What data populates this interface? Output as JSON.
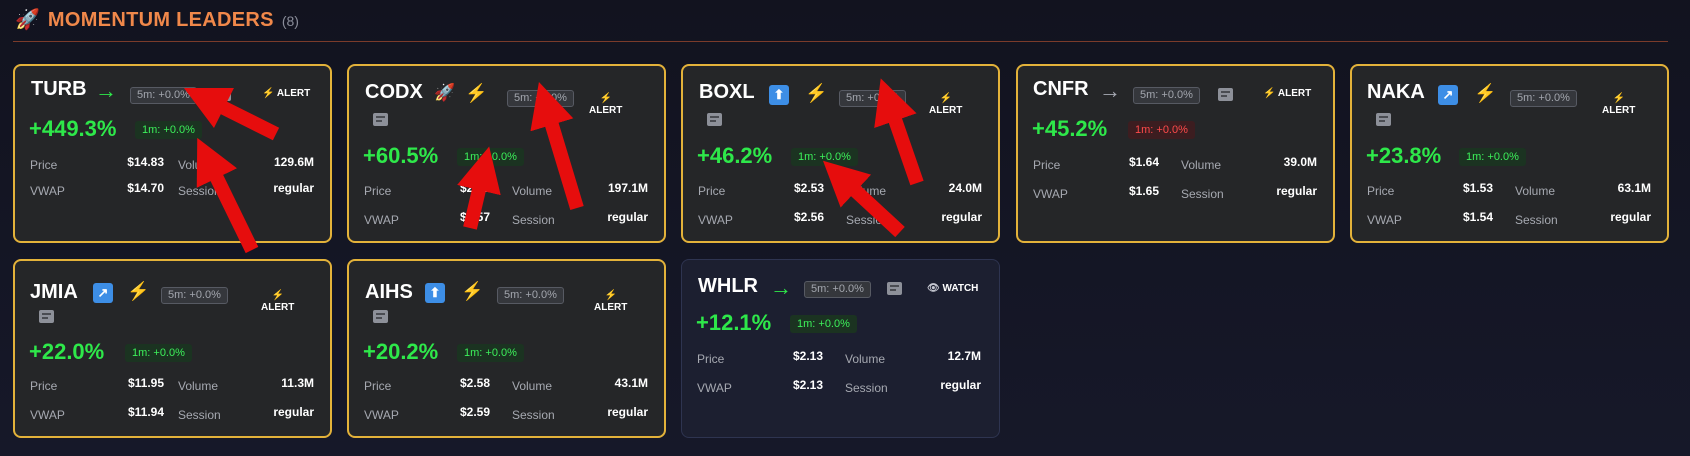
{
  "header": {
    "icon": "rocket-icon",
    "title": "MOMENTUM LEADERS",
    "count": "(8)"
  },
  "labels": {
    "price": "Price",
    "vwap": "VWAP",
    "volume": "Volume",
    "session": "Session"
  },
  "colors": {
    "accent": "#f0884a",
    "gain": "#2ee84a",
    "alert_border": "#e3b23a",
    "loss": "#ff4a4a"
  },
  "cards": [
    {
      "symbol": "TURB",
      "trend": "→",
      "trend_icon": "arrow-right-icon",
      "m5": "5m: +0.0%",
      "status": "ALERT",
      "pct": "+449.3%",
      "m1": "1m: +0.0%",
      "price": "$14.83",
      "vwap": "$14.70",
      "volume": "129.6M",
      "session": "regular"
    },
    {
      "symbol": "CODX",
      "badge": "🚀",
      "m5": "5m: +0.0%",
      "status": "ALERT",
      "pct": "+60.5%",
      "m1": "1m: +0.0%",
      "price": "$2.77",
      "vwap": "$2.57",
      "volume": "197.1M",
      "session": "regular"
    },
    {
      "symbol": "BOXL",
      "badge": "⬆",
      "m5": "5m: +0.0%",
      "status": "ALERT",
      "pct": "+46.2%",
      "m1": "1m: +0.0%",
      "price": "$2.53",
      "vwap": "$2.56",
      "volume": "24.0M",
      "session": "regular"
    },
    {
      "symbol": "CNFR",
      "trend": "→",
      "trend_icon": "arrow-right-icon",
      "m5": "5m: +0.0%",
      "status": "ALERT",
      "pct": "+45.2%",
      "m1": "1m: +0.0%",
      "price": "$1.64",
      "vwap": "$1.65",
      "volume": "39.0M",
      "session": "regular"
    },
    {
      "symbol": "NAKA",
      "badge": "↗",
      "m5": "5m: +0.0%",
      "status": "ALERT",
      "pct": "+23.8%",
      "m1": "1m: +0.0%",
      "price": "$1.53",
      "vwap": "$1.54",
      "volume": "63.1M",
      "session": "regular"
    },
    {
      "symbol": "JMIA",
      "badge": "↗",
      "m5": "5m: +0.0%",
      "status": "ALERT",
      "pct": "+22.0%",
      "m1": "1m: +0.0%",
      "price": "$11.95",
      "vwap": "$11.94",
      "volume": "11.3M",
      "session": "regular"
    },
    {
      "symbol": "AIHS",
      "badge": "⬆",
      "m5": "5m: +0.0%",
      "status": "ALERT",
      "pct": "+20.2%",
      "m1": "1m: +0.0%",
      "price": "$2.58",
      "vwap": "$2.59",
      "volume": "43.1M",
      "session": "regular"
    },
    {
      "symbol": "WHLR",
      "trend": "→",
      "trend_icon": "arrow-right-icon",
      "m5": "5m: +0.0%",
      "status": "WATCH",
      "pct": "+12.1%",
      "m1": "1m: +0.0%",
      "price": "$2.13",
      "vwap": "$2.13",
      "volume": "12.7M",
      "session": "regular"
    }
  ]
}
